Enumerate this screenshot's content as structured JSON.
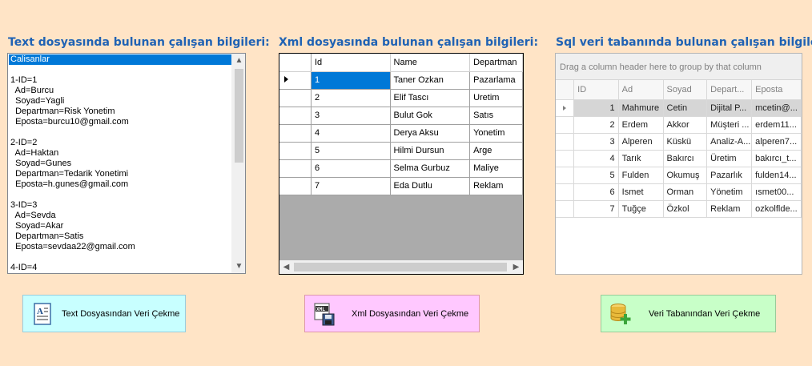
{
  "headings": {
    "text": "Text dosyasında bulunan çalışan bilgileri:",
    "xml": "Xml dosyasında bulunan çalışan bilgileri:",
    "sql": "Sql veri tabanında bulunan çalışan bilgileri:"
  },
  "listbox": {
    "items": [
      "Calisanlar",
      "",
      "1-ID=1",
      "  Ad=Burcu",
      "  Soyad=Yagli",
      "  Departman=Risk Yonetim",
      "  Eposta=burcu10@gmail.com",
      "",
      "2-ID=2",
      "  Ad=Haktan",
      "  Soyad=Gunes",
      "  Departman=Tedarik Yonetimi",
      "  Eposta=h.gunes@gmail.com",
      "",
      "3-ID=3",
      "  Ad=Sevda",
      "  Soyad=Akar",
      "  Departman=Satis",
      "  Eposta=sevdaa22@gmail.com",
      "",
      "4-ID=4"
    ]
  },
  "xml_grid": {
    "columns": [
      "Id",
      "Name",
      "Departman"
    ],
    "rows": [
      [
        "1",
        "Taner Ozkan",
        "Pazarlama"
      ],
      [
        "2",
        "Elif Tascı",
        "Uretim"
      ],
      [
        "3",
        "Bulut Gok",
        "Satıs"
      ],
      [
        "4",
        "Derya Aksu",
        "Yonetim"
      ],
      [
        "5",
        "Hilmi Dursun",
        "Arge"
      ],
      [
        "6",
        "Selma Gurbuz",
        "Maliye"
      ],
      [
        "7",
        "Eda Dutlu",
        "Reklam"
      ]
    ]
  },
  "sql_grid": {
    "group_panel": "Drag a column header here to group by that column",
    "columns": [
      "ID",
      "Ad",
      "Soyad",
      "Depart...",
      "Eposta"
    ],
    "rows": [
      [
        "1",
        "Mahmure",
        "Cetin",
        "Dijital P...",
        "mcetin@..."
      ],
      [
        "2",
        "Erdem",
        "Akkor",
        "Müşteri ...",
        "erdem11..."
      ],
      [
        "3",
        "Alperen",
        "Küskü",
        "Analiz-A...",
        "alperen7..."
      ],
      [
        "4",
        "Tarık",
        "Bakırcı",
        "Üretim",
        "bakırcı_t..."
      ],
      [
        "5",
        "Fulden",
        "Okumuş",
        "Pazarlık",
        "fulden14..."
      ],
      [
        "6",
        "Ismet",
        "Orman",
        "Yönetim",
        "ısmet00..."
      ],
      [
        "7",
        "Tuğçe",
        "Özkol",
        "Reklam",
        "ozkolflde..."
      ]
    ]
  },
  "buttons": {
    "text": "Text Dosyasından Veri Çekme",
    "xml": "Xml Dosyasından Veri Çekme",
    "sql": "Veri Tabanından Veri Çekme"
  },
  "colors": {
    "background": "#ffe4c6",
    "heading": "#1f62b4",
    "selection": "#0078d7",
    "btn_text": "#c8ffff",
    "btn_xml": "#ffc8ff",
    "btn_sql": "#c8ffc8"
  },
  "icons": {
    "text_button": "text-document-icon",
    "xml_button": "xml-save-icon",
    "sql_button": "database-add-icon"
  }
}
